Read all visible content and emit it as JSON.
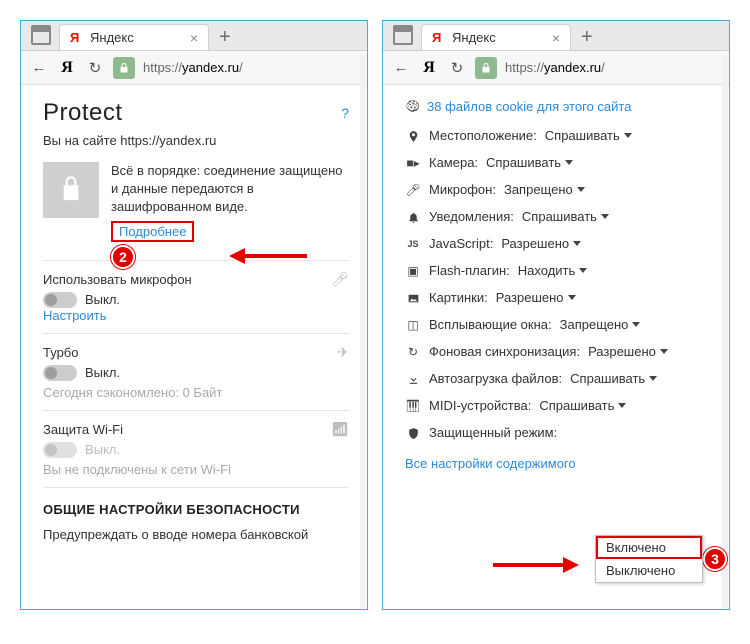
{
  "tab": {
    "title": "Яндекс",
    "new_tab": "+"
  },
  "toolbar": {
    "back": "←",
    "yandex": "Я",
    "reload": "↻",
    "url_scheme": "https://",
    "url_host": "yandex.ru",
    "url_path": "/"
  },
  "left": {
    "protect_title": "Protect",
    "help": "?",
    "site_line": "Вы на сайте https://yandex.ru",
    "secure_text": "Всё в порядке: соединение защищено и данные передаются в зашифрованном виде.",
    "details": "Подробнее",
    "mic": {
      "title": "Использовать микрофон",
      "state": "Выкл.",
      "configure": "Настроить"
    },
    "turbo": {
      "title": "Турбо",
      "state": "Выкл.",
      "saved": "Сегодня сэкономлено: 0 Байт"
    },
    "wifi": {
      "title": "Защита Wi-Fi",
      "state": "Выкл.",
      "note": "Вы не подключены к сети Wi-Fi"
    },
    "section": "ОБЩИЕ НАСТРОЙКИ БЕЗОПАСНОСТИ",
    "warn_line": "Предупреждать о вводе номера банковской"
  },
  "right": {
    "cookies": "38 файлов cookie для этого сайта",
    "perms": [
      {
        "icon": "location",
        "label": "Местоположение:",
        "value": "Спрашивать"
      },
      {
        "icon": "camera",
        "label": "Камера:",
        "value": "Спрашивать"
      },
      {
        "icon": "mic",
        "label": "Микрофон:",
        "value": "Запрещено"
      },
      {
        "icon": "bell",
        "label": "Уведомления:",
        "value": "Спрашивать"
      },
      {
        "icon": "js",
        "label": "JavaScript:",
        "value": "Разрешено"
      },
      {
        "icon": "flash",
        "label": "Flash-плагин:",
        "value": "Находить"
      },
      {
        "icon": "images",
        "label": "Картинки:",
        "value": "Разрешено"
      },
      {
        "icon": "popup",
        "label": "Всплывающие окна:",
        "value": "Запрещено"
      },
      {
        "icon": "sync",
        "label": "Фоновая синхронизация:",
        "value": "Разрешено"
      },
      {
        "icon": "download",
        "label": "Автозагрузка файлов:",
        "value": "Спрашивать"
      },
      {
        "icon": "midi",
        "label": "MIDI-устройства:",
        "value": "Спрашивать"
      },
      {
        "icon": "shield",
        "label": "Защищенный режим:",
        "value": ""
      }
    ],
    "dropdown": {
      "on": "Включено",
      "off": "Выключено"
    },
    "all_settings": "Все настройки содержимого"
  },
  "callouts": {
    "two": "2",
    "three": "3"
  }
}
